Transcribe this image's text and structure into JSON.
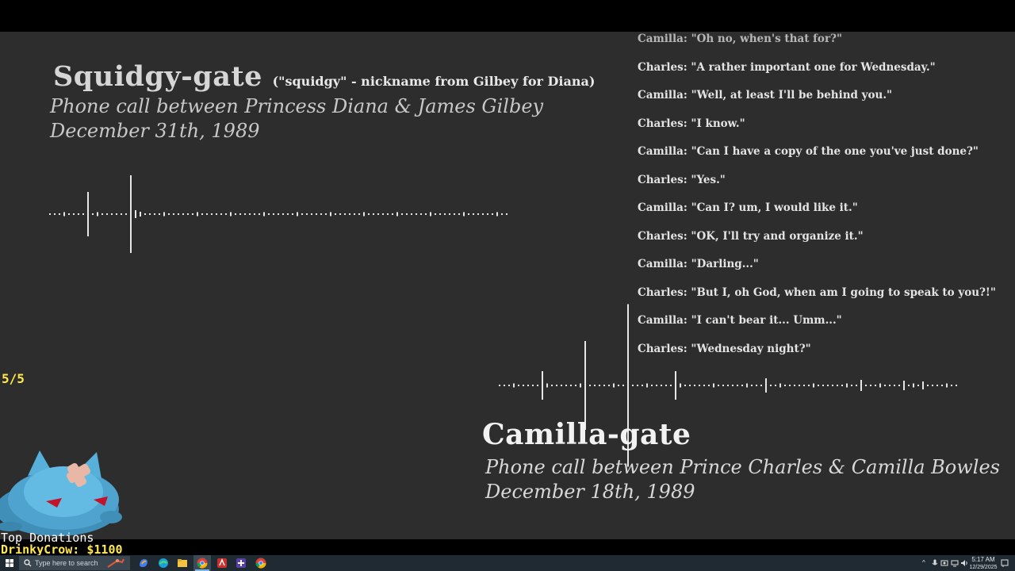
{
  "video": {
    "left_title": {
      "name": "Squidgy-gate",
      "note": "(\"squidgy\" - nickname from Gilbey for Diana)",
      "line1": "Phone call between Princess Diana & James Gilbey",
      "line2": "December 31th, 1989"
    },
    "right_title": {
      "name": "Camilla-gate",
      "line1": "Phone call between Prince Charles & Camilla Bowles",
      "line2": "December 18th, 1989"
    },
    "transcript": [
      "Camilla: \"Oh no, when's that for?\"",
      "Charles: \"A rather important one for Wednesday.\"",
      "Camilla: \"Well, at least I'll be behind you.\"",
      "Charles: \"I know.\"",
      "Camilla: \"Can I have a copy of the one you've just done?\"",
      "Charles: \"Yes.\"",
      "Camilla: \"Can I? um, I would like it.\"",
      "Charles: \"OK, I'll try and organize it.\"",
      "Camilla: \"Darling...\"",
      "Charles: \"But I, oh God, when am I going to speak to you?!\"",
      "Camilla: \"I can't bear it... Umm...\"",
      "Charles: \"Wednesday night?\""
    ]
  },
  "overlay": {
    "counter": "5/5",
    "donations_title": "Top Donations",
    "donations": [
      {
        "name": "DrinkyCrow",
        "amount": "$1100",
        "label": "DrinkyCrow: $1100"
      }
    ]
  },
  "taskbar": {
    "search_placeholder": "Type here to search",
    "time": "5:17 AM",
    "date": "12/29/2025",
    "pinned_icons": [
      "start-icon",
      "copilot-icon",
      "edge-icon",
      "file-explorer-icon",
      "chrome-icon",
      "red-app-icon",
      "game-controller-icon",
      "chrome-icon"
    ]
  }
}
